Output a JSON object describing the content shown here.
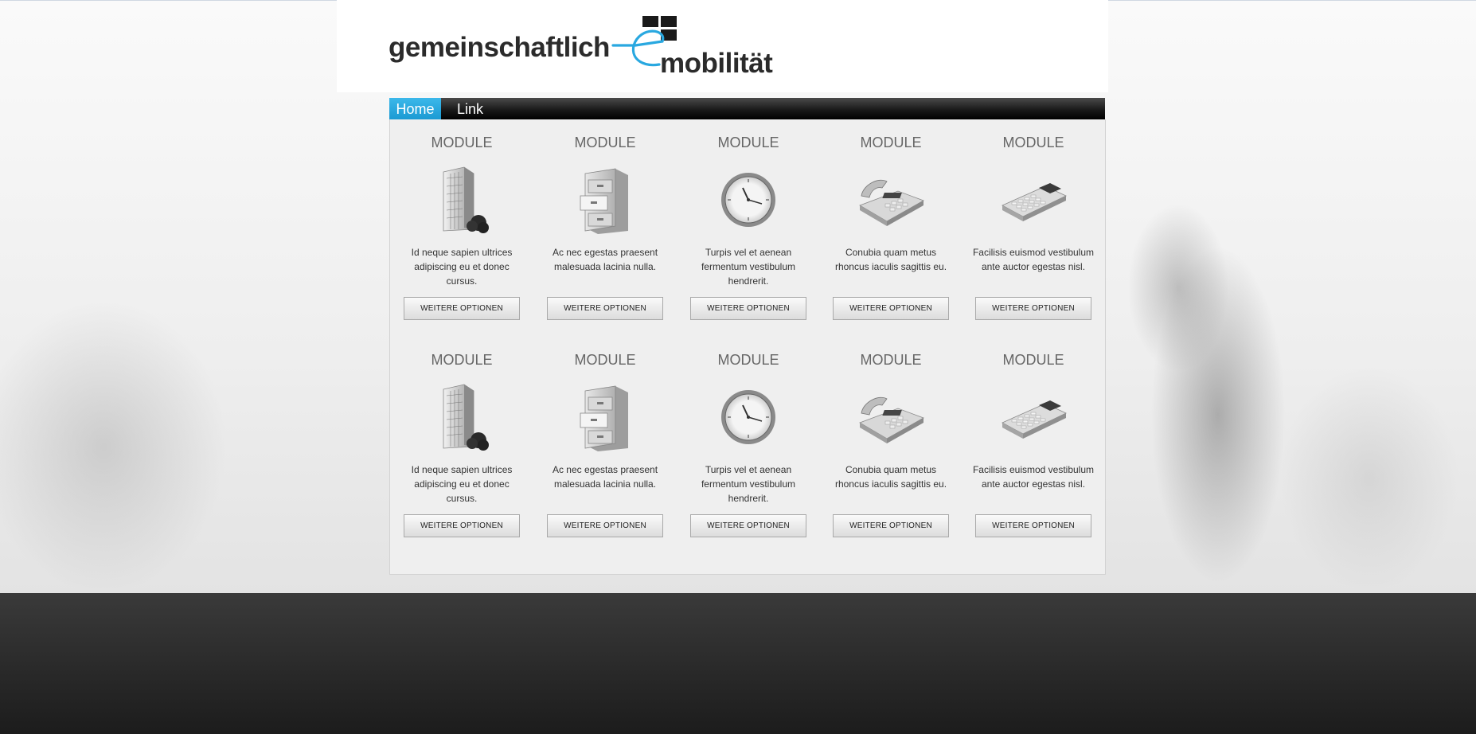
{
  "logo": {
    "part1": "gemeinschaftlich",
    "part2": "mobilität"
  },
  "nav": {
    "home": "Home",
    "link": "Link"
  },
  "modules_row1": [
    {
      "title": "MODULE",
      "icon": "office-building-icon",
      "desc": "Id neque sapien ultrices adipiscing eu et donec cursus.",
      "button": "WEITERE OPTIONEN"
    },
    {
      "title": "MODULE",
      "icon": "file-cabinet-icon",
      "desc": "Ac nec egestas praesent malesuada lacinia nulla.",
      "button": "WEITERE OPTIONEN"
    },
    {
      "title": "MODULE",
      "icon": "clock-icon",
      "desc": "Turpis vel et aenean fermentum vestibulum hendrerit.",
      "button": "WEITERE OPTIONEN"
    },
    {
      "title": "MODULE",
      "icon": "telephone-icon",
      "desc": "Conubia quam metus rhoncus iaculis sagittis eu.",
      "button": "WEITERE OPTIONEN"
    },
    {
      "title": "MODULE",
      "icon": "calculator-icon",
      "desc": "Facilisis euismod vestibulum ante auctor egestas nisl.",
      "button": "WEITERE OPTIONEN"
    }
  ],
  "modules_row2": [
    {
      "title": "MODULE",
      "icon": "office-building-icon",
      "desc": "Id neque sapien ultrices adipiscing eu et donec cursus.",
      "button": "WEITERE OPTIONEN"
    },
    {
      "title": "MODULE",
      "icon": "file-cabinet-icon",
      "desc": "Ac nec egestas praesent malesuada lacinia nulla.",
      "button": "WEITERE OPTIONEN"
    },
    {
      "title": "MODULE",
      "icon": "clock-icon",
      "desc": "Turpis vel et aenean fermentum vestibulum hendrerit.",
      "button": "WEITERE OPTIONEN"
    },
    {
      "title": "MODULE",
      "icon": "telephone-icon",
      "desc": "Conubia quam metus rhoncus iaculis sagittis eu.",
      "button": "WEITERE OPTIONEN"
    },
    {
      "title": "MODULE",
      "icon": "calculator-icon",
      "desc": "Facilisis euismod vestibulum ante auctor egestas nisl.",
      "button": "WEITERE OPTIONEN"
    }
  ],
  "colors": {
    "accent": "#1b9ad3",
    "logo_accent": "#29a8e0",
    "footer": "#2a2a2a"
  }
}
